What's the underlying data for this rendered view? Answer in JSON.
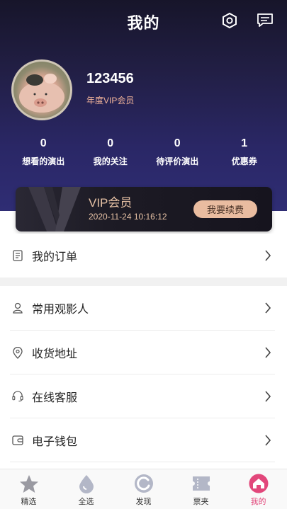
{
  "header": {
    "title": "我的",
    "settings_icon": "settings-hexagon-icon",
    "message_icon": "message-icon"
  },
  "profile": {
    "username": "123456",
    "member_level": "年度VIP会员"
  },
  "stats": [
    {
      "value": "0",
      "label": "想看的演出"
    },
    {
      "value": "0",
      "label": "我的关注"
    },
    {
      "value": "0",
      "label": "待评价演出"
    },
    {
      "value": "1",
      "label": "优惠券"
    }
  ],
  "vip_card": {
    "title": "VIP会员",
    "date": "2020-11-24 10:16:12",
    "renew_label": "我要续费"
  },
  "menu": {
    "orders": "我的订单",
    "viewers": "常用观影人",
    "address": "收货地址",
    "service": "在线客服",
    "wallet": "电子钱包"
  },
  "tabbar": [
    {
      "label": "精选",
      "icon": "star-icon"
    },
    {
      "label": "全选",
      "icon": "drop-icon"
    },
    {
      "label": "发现",
      "icon": "discover-icon"
    },
    {
      "label": "票夹",
      "icon": "ticket-icon"
    },
    {
      "label": "我的",
      "icon": "home-icon"
    }
  ],
  "colors": {
    "header_dark": "#17152a",
    "header_purple": "#2f2d74",
    "accent_pink": "#e2477b",
    "vip_gold": "#e8c3a6",
    "renew_bg": "#e9bca0"
  }
}
